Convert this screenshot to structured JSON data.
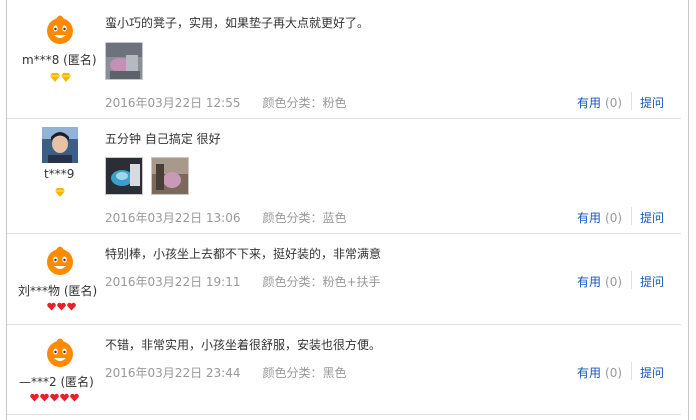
{
  "reviews": [
    {
      "user": "m***8 (匿名)",
      "content": "蛮小巧的凳子，实用，如果垫子再大点就更好了。",
      "date": "2016年03月22日 12:55",
      "spec": "颜色分类：粉色",
      "useful_label": "有用",
      "useful_count": "(0)",
      "ask_label": "提问",
      "badge": "gold-diamond",
      "badge_count": 2,
      "thumb_count": 1
    },
    {
      "user": "t***9",
      "content": "五分钟 自己搞定 很好",
      "date": "2016年03月22日 13:06",
      "spec": "颜色分类：蓝色",
      "useful_label": "有用",
      "useful_count": "(0)",
      "ask_label": "提问",
      "badge": "gold-diamond",
      "badge_count": 1,
      "thumb_count": 2
    },
    {
      "user": "刘***物 (匿名)",
      "content": "特别棒，小孩坐上去都不下来，挺好装的，非常满意",
      "date": "2016年03月22日 19:11",
      "spec": "颜色分类：粉色+扶手",
      "useful_label": "有用",
      "useful_count": "(0)",
      "ask_label": "提问",
      "badge": "red-heart",
      "badge_count": 3,
      "thumb_count": 0
    },
    {
      "user": "—***2 (匿名)",
      "content": "不错，非常实用，小孩坐着很舒服，安装也很方便。",
      "date": "2016年03月22日 23:44",
      "spec": "颜色分类：黑色",
      "useful_label": "有用",
      "useful_count": "(0)",
      "ask_label": "提问",
      "badge": "red-heart",
      "badge_count": 5,
      "thumb_count": 0
    }
  ],
  "colors": {
    "link": "#1a56b8",
    "meta": "#999999",
    "avatar_orange": "#ff8a00",
    "gold": "#f5b700",
    "heart_red": "#e8202a"
  }
}
